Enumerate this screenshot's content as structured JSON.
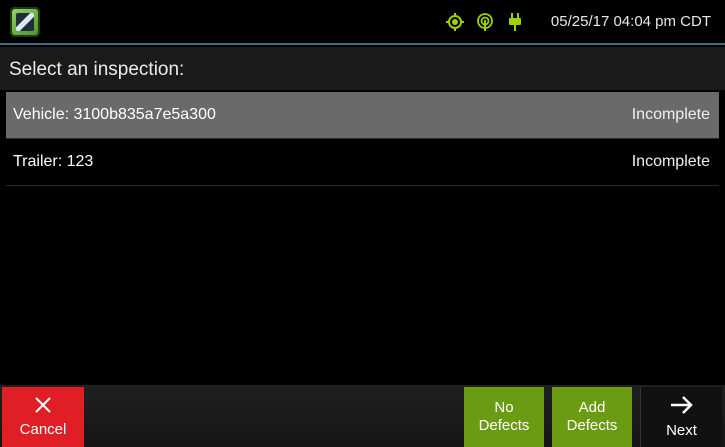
{
  "status_bar": {
    "app_icon": "inspection-app-icon",
    "icons": [
      "gps-icon",
      "wireless-icon",
      "plug-power-icon"
    ],
    "datetime": "05/25/17 04:04 pm CDT",
    "accent_color": "#9bd200"
  },
  "screen": {
    "title": "Select an inspection:"
  },
  "inspections": [
    {
      "name": "Vehicle: 3100b835a7e5a300",
      "status": "Incomplete",
      "selected": true
    },
    {
      "name": "Trailer: 123",
      "status": "Incomplete",
      "selected": false
    }
  ],
  "footer": {
    "cancel": {
      "label": "Cancel",
      "icon": "x-icon",
      "color": "#e01e26"
    },
    "no_defects": {
      "label_line1": "No",
      "label_line2": "Defects",
      "color": "#6a9b12"
    },
    "add_defects": {
      "label_line1": "Add",
      "label_line2": "Defects",
      "color": "#6a9b12"
    },
    "next": {
      "label": "Next",
      "icon": "arrow-right-icon"
    }
  }
}
